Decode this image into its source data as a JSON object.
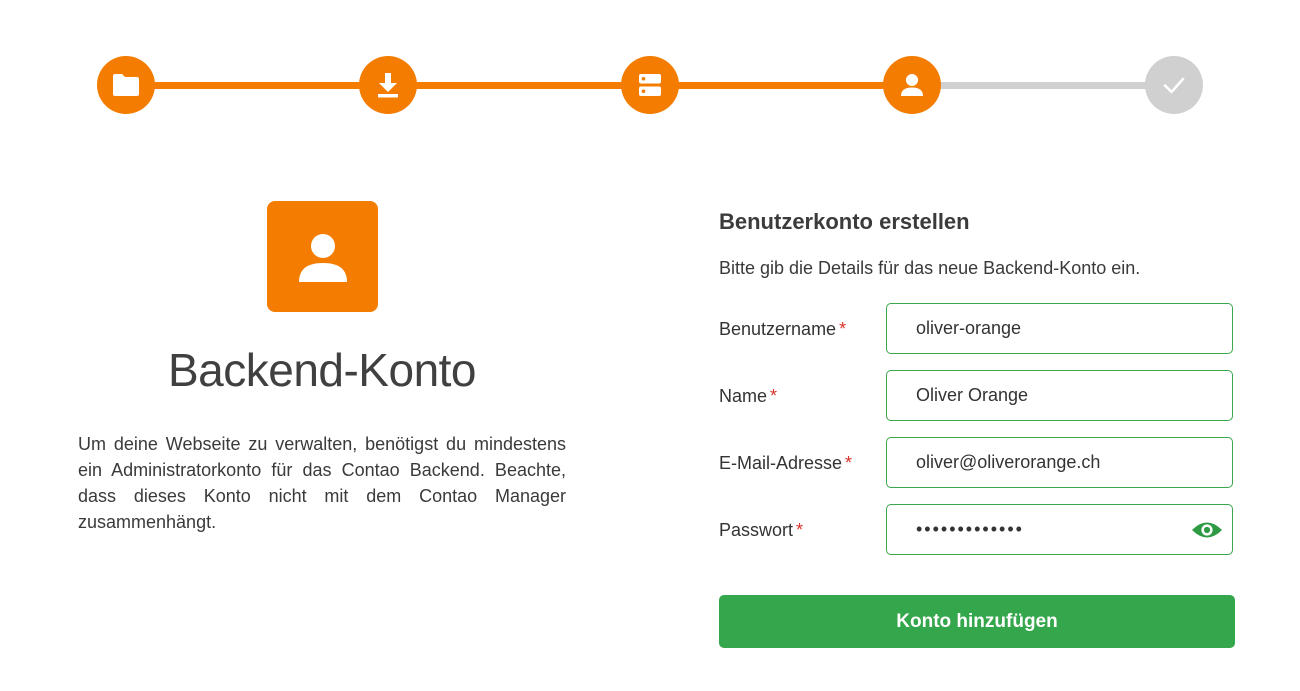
{
  "stepper": {
    "steps": [
      {
        "icon": "folder-icon",
        "state": "done"
      },
      {
        "icon": "download-icon",
        "state": "done"
      },
      {
        "icon": "database-icon",
        "state": "done"
      },
      {
        "icon": "user-icon",
        "state": "current"
      },
      {
        "icon": "check-icon",
        "state": "todo"
      }
    ],
    "active_color": "#f47c00",
    "inactive_color": "#d0d0d0"
  },
  "intro": {
    "icon": "user-icon",
    "title": "Backend-Konto",
    "text": "Um deine Webseite zu verwalten, benötigst du mindestens ein Administratorkonto für das Contao Backend. Beachte, dass dieses Konto nicht mit dem Contao Manager zusammenhängt."
  },
  "form": {
    "heading": "Benutzerkonto erstellen",
    "description": "Bitte gib die Details für das neue Backend-Konto ein.",
    "required_marker": "*",
    "fields": {
      "username": {
        "label": "Benutzername",
        "value": "oliver-orange"
      },
      "name": {
        "label": "Name",
        "value": "Oliver Orange"
      },
      "email": {
        "label": "E-Mail-Adresse",
        "value": "oliver@oliverorange.ch"
      },
      "password": {
        "label": "Passwort",
        "value": "•••••••••••••",
        "toggle_icon": "eye-icon"
      }
    },
    "submit_label": "Konto hinzufügen",
    "accent_color": "#34a64b"
  }
}
